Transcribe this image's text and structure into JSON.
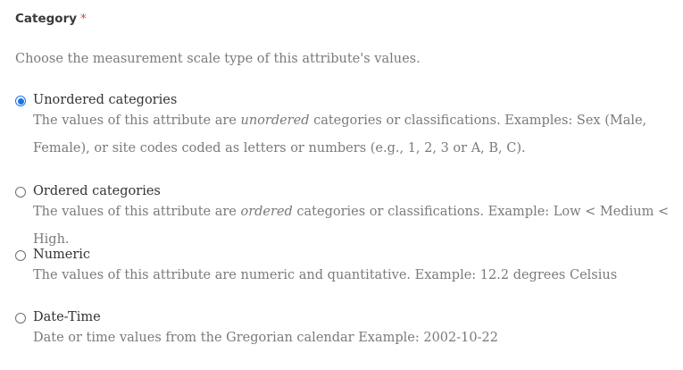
{
  "field": {
    "label": "Category",
    "required_mark": "*"
  },
  "help_text": "Choose the measurement scale type of this attribute's values.",
  "options": [
    {
      "label": "Unordered categories",
      "selected": true,
      "desc_before": "The values of this attribute are ",
      "desc_emphasis": "unordered",
      "desc_after": " categories or classifications. Examples: Sex (Male, Female), or site codes coded as letters or numbers (e.g., 1, 2, 3 or A, B, C)."
    },
    {
      "label": "Ordered categories",
      "selected": false,
      "desc_before": "The values of this attribute are ",
      "desc_emphasis": "ordered",
      "desc_after": " categories or classifications. Example: Low < Medium < High."
    },
    {
      "label": "Numeric",
      "selected": false,
      "desc_before": "The values of this attribute are numeric and quantitative. Example: 12.2 degrees Celsius",
      "desc_emphasis": "",
      "desc_after": ""
    },
    {
      "label": "Date-Time",
      "selected": false,
      "desc_before": "Date or time values from the Gregorian calendar Example: 2002-10-22",
      "desc_emphasis": "",
      "desc_after": ""
    }
  ],
  "colors": {
    "accent": "#1a73e8",
    "required": "#d0453f",
    "muted_text": "#7a7a7a"
  }
}
